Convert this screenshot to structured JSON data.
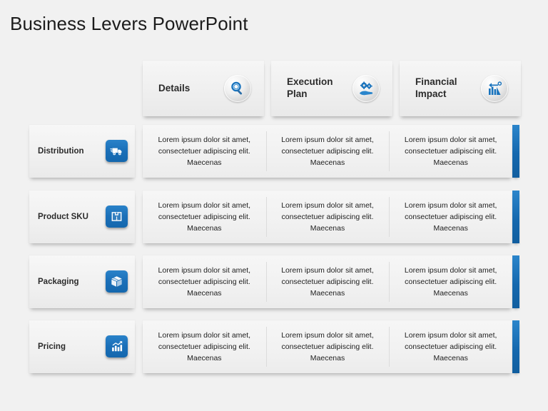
{
  "slide": {
    "title": "Business Levers PowerPoint",
    "background_color": "#f1f1f1",
    "accent_color": "#1568ae",
    "badge_color": "#1a6fb8",
    "text_color": "#2b2b2b"
  },
  "columns": [
    {
      "label": "Details",
      "icon": "magnifier-icon"
    },
    {
      "label": "Execution Plan",
      "icon": "gears-on-hand-icon"
    },
    {
      "label": "Financial Impact",
      "icon": "bar-chart-arrow-icon"
    }
  ],
  "rows": [
    {
      "label": "Distribution",
      "icon": "delivery-truck-icon",
      "cells": [
        "Lorem ipsum dolor sit amet, consectetuer adipiscing elit. Maecenas",
        "Lorem ipsum dolor sit amet, consectetuer adipiscing elit. Maecenas",
        "Lorem ipsum dolor sit amet, consectetuer adipiscing elit. Maecenas"
      ]
    },
    {
      "label": "Product SKU",
      "icon": "package-box-icon",
      "cells": [
        "Lorem ipsum dolor sit amet, consectetuer adipiscing elit. Maecenas",
        "Lorem ipsum dolor sit amet, consectetuer adipiscing elit. Maecenas",
        "Lorem ipsum dolor sit amet, consectetuer adipiscing elit. Maecenas"
      ]
    },
    {
      "label": "Packaging",
      "icon": "cube-box-icon",
      "cells": [
        "Lorem ipsum dolor sit amet, consectetuer adipiscing elit. Maecenas",
        "Lorem ipsum dolor sit amet, consectetuer adipiscing elit. Maecenas",
        "Lorem ipsum dolor sit amet, consectetuer adipiscing elit. Maecenas"
      ]
    },
    {
      "label": "Pricing",
      "icon": "growth-chart-icon",
      "cells": [
        "Lorem ipsum dolor sit amet, consectetuer adipiscing elit. Maecenas",
        "Lorem ipsum dolor sit amet, consectetuer adipiscing elit. Maecenas",
        "Lorem ipsum dolor sit amet, consectetuer adipiscing elit. Maecenas"
      ]
    }
  ]
}
